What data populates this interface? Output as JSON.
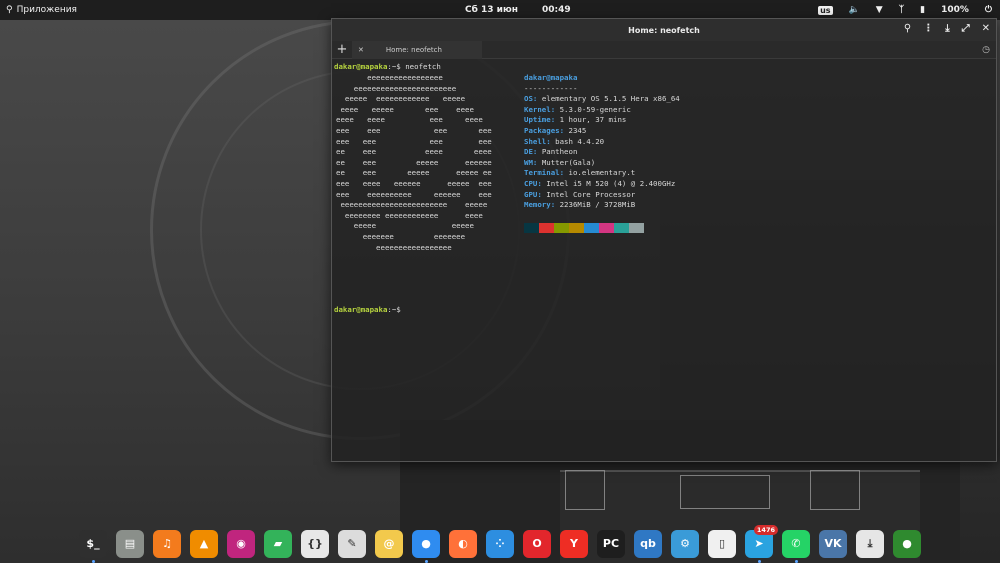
{
  "panel": {
    "apps_label": "Приложения",
    "date": "Сб 13 июн",
    "time": "00:49",
    "keyboard_layout": "us",
    "battery": "100%"
  },
  "terminal": {
    "title": "Home: neofetch",
    "tab_label": "Home: neofetch",
    "prompt_user": "dakar@mapaka",
    "prompt_suffix": ":~$ ",
    "command": "neofetch",
    "ascii_art": "       eeeeeeeeeeeeeeeee\n    eeeeeeeeeeeeeeeeeeeeeee\n  eeeee  eeeeeeeeeeee   eeeee\n eeee   eeeee       eee    eeee\neeee   eeee          eee     eeee\neee    eee            eee       eee\neee   eee            eee        eee\nee    eee           eeee       eeee\nee    eee         eeeee      eeeeee\nee    eee       eeeee      eeeee ee\neee   eeee   eeeeee      eeeee  eee\neee    eeeeeeeeee     eeeeee    eee\n eeeeeeeeeeeeeeeeeeeeeeee    eeeee\n  eeeeeeee eeeeeeeeeeee      eeee\n    eeeee                 eeeee\n      eeeeeee         eeeeeee\n         eeeeeeeeeeeeeeeee",
    "info_user": "dakar@mapaka",
    "info_sep": "------------",
    "info": [
      {
        "k": "OS",
        "v": "elementary OS 5.1.5 Hera x86_64"
      },
      {
        "k": "Kernel",
        "v": "5.3.0-59-generic"
      },
      {
        "k": "Uptime",
        "v": "1 hour, 37 mins"
      },
      {
        "k": "Packages",
        "v": "2345"
      },
      {
        "k": "Shell",
        "v": "bash 4.4.20"
      },
      {
        "k": "DE",
        "v": "Pantheon"
      },
      {
        "k": "WM",
        "v": "Mutter(Gala)"
      },
      {
        "k": "Terminal",
        "v": "io.elementary.t"
      },
      {
        "k": "CPU",
        "v": "Intel i5 M 520 (4) @ 2.400GHz"
      },
      {
        "k": "GPU",
        "v": "Intel Core Processor"
      },
      {
        "k": "Memory",
        "v": "2236MiB / 3728MiB"
      }
    ],
    "palette": [
      "#073642",
      "#dc322f",
      "#859900",
      "#b58900",
      "#268bd2",
      "#d33682",
      "#2aa198",
      "#93a1a1"
    ]
  },
  "dock": [
    {
      "name": "terminal",
      "glyph": "$_",
      "color": "#2f2f2f",
      "running": true
    },
    {
      "name": "files",
      "glyph": "▤",
      "color": "#8a8f8a",
      "running": false
    },
    {
      "name": "music",
      "glyph": "♫",
      "color": "#f37b1d",
      "running": false
    },
    {
      "name": "vlc",
      "glyph": "▲",
      "color": "#f08c00",
      "running": false
    },
    {
      "name": "eye-of-gnome",
      "glyph": "◉",
      "color": "#c0257e",
      "running": false
    },
    {
      "name": "photos",
      "glyph": "▰",
      "color": "#33b35a",
      "running": false
    },
    {
      "name": "code",
      "glyph": "{}",
      "color": "#e8e8e8",
      "running": false
    },
    {
      "name": "text-editor",
      "glyph": "✎",
      "color": "#dcdcdc",
      "running": false
    },
    {
      "name": "mail",
      "glyph": "@",
      "color": "#f2c94c",
      "running": false
    },
    {
      "name": "chrome",
      "glyph": "●",
      "color": "#2f8cf0",
      "running": true
    },
    {
      "name": "firefox",
      "glyph": "◐",
      "color": "#ff7139",
      "running": false
    },
    {
      "name": "settings-network",
      "glyph": "⁘",
      "color": "#2d8ee0",
      "running": false
    },
    {
      "name": "opera",
      "glyph": "O",
      "color": "#e2262c",
      "running": false
    },
    {
      "name": "yandex-browser",
      "glyph": "Y",
      "color": "#ee2d24",
      "running": false
    },
    {
      "name": "pycharm",
      "glyph": "PC",
      "color": "#1e1e1e",
      "running": false
    },
    {
      "name": "qbittorrent",
      "glyph": "qb",
      "color": "#2f78c4",
      "running": false
    },
    {
      "name": "steam",
      "glyph": "⚙",
      "color": "#3a9bd8",
      "running": false
    },
    {
      "name": "document",
      "glyph": "▯",
      "color": "#f0f0f0",
      "running": false
    },
    {
      "name": "telegram",
      "glyph": "➤",
      "color": "#2aa3e0",
      "running": true,
      "badge": "1476"
    },
    {
      "name": "whatsapp",
      "glyph": "✆",
      "color": "#25d366",
      "running": true
    },
    {
      "name": "vk",
      "glyph": "VK",
      "color": "#4a76a8",
      "running": false
    },
    {
      "name": "downloads",
      "glyph": "⤓",
      "color": "#e6e6e6",
      "running": false
    },
    {
      "name": "orb",
      "glyph": "●",
      "color": "#2f8a2f",
      "running": false
    }
  ]
}
